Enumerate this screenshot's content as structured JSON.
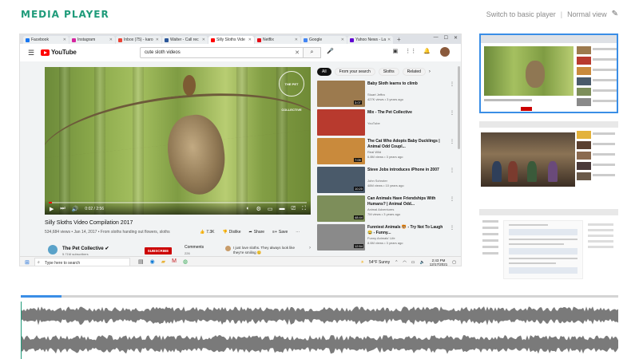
{
  "header": {
    "title": "MEDIA PLAYER",
    "switch_label": "Switch to basic player",
    "normal_view_label": "Normal view"
  },
  "browser": {
    "tabs": [
      {
        "label": "Facebook",
        "color": "#1877f2",
        "active": false
      },
      {
        "label": "Instagram",
        "color": "#d6249f",
        "active": false
      },
      {
        "label": "Inbox (75) - karo",
        "color": "#ea4335",
        "active": false
      },
      {
        "label": "Walter - Call rec",
        "color": "#2b579a",
        "active": false
      },
      {
        "label": "Silly Sloths Vide",
        "color": "#ff0000",
        "active": true
      },
      {
        "label": "Netflix",
        "color": "#e50914",
        "active": false
      },
      {
        "label": "Google",
        "color": "#4285f4",
        "active": false
      },
      {
        "label": "Yahoo News - La",
        "color": "#6001d2",
        "active": false
      }
    ]
  },
  "youtube": {
    "logo_text": "YouTube",
    "search_query": "cute sloth videos",
    "video_badge": "THE PET COLLECTIVE",
    "time": "0:02 / 2:56",
    "progress": 0.012,
    "video_title": "Silly Sloths Video Compilation 2017",
    "video_meta": "534,684 views • Jan 14, 2017 • From sloths handing out flowers, sloths",
    "likes": "7.3K",
    "dislike_label": "Dislike",
    "share_label": "Share",
    "save_label": "Save",
    "channel_name": "The Pet Collective",
    "channel_subs": "5.71M subscribers",
    "subscribe_label": "SUBSCRIBE",
    "comments_label": "Comments",
    "comments_count": "226",
    "comment_text": "I just love sloths. They always look like they're smiling 😊",
    "chips": [
      "All",
      "From your search",
      "Sloths",
      "Related"
    ],
    "recommended": [
      {
        "title": "Baby Sloth learns to climb",
        "channel": "Stuart Jeffra",
        "views": "427K views • 3 years ago",
        "duration": "3:07",
        "color": "#9c7a4e"
      },
      {
        "title": "Mix - The Pet Collective",
        "channel": "YouTube",
        "views": "",
        "duration": "",
        "color": "#b83a2e"
      },
      {
        "title": "The Cat Who Adopts Baby Ducklings | Animal Odd Coupl...",
        "channel": "Real Wild",
        "views": "6.8M views • 3 years ago",
        "duration": "7:09",
        "color": "#c98a3c"
      },
      {
        "title": "Steve Jobs introduces iPhone in 2007",
        "channel": "John Schroter",
        "views": "48M views • 10 years ago",
        "duration": "10:20",
        "color": "#4a5a6a"
      },
      {
        "title": "Can Animals Have Friendships With Humans? | Animal Odd...",
        "channel": "Animal Adventures",
        "views": "7M views • 3 years ago",
        "duration": "48:44",
        "color": "#7d8e5a"
      },
      {
        "title": "Funniest Animals 🐯 - Try Not To Laugh 😂 - Funny...",
        "channel": "Funny Animals' Life",
        "views": "8.6M views • 3 years ago",
        "duration": "12:54",
        "color": "#8a8a8a"
      }
    ]
  },
  "taskbar": {
    "search_placeholder": "Type here to search",
    "weather": "54°F  Sunny",
    "time": "2:43 PM",
    "date": "12/17/2021"
  },
  "timeline": {
    "progress": 0.068
  }
}
